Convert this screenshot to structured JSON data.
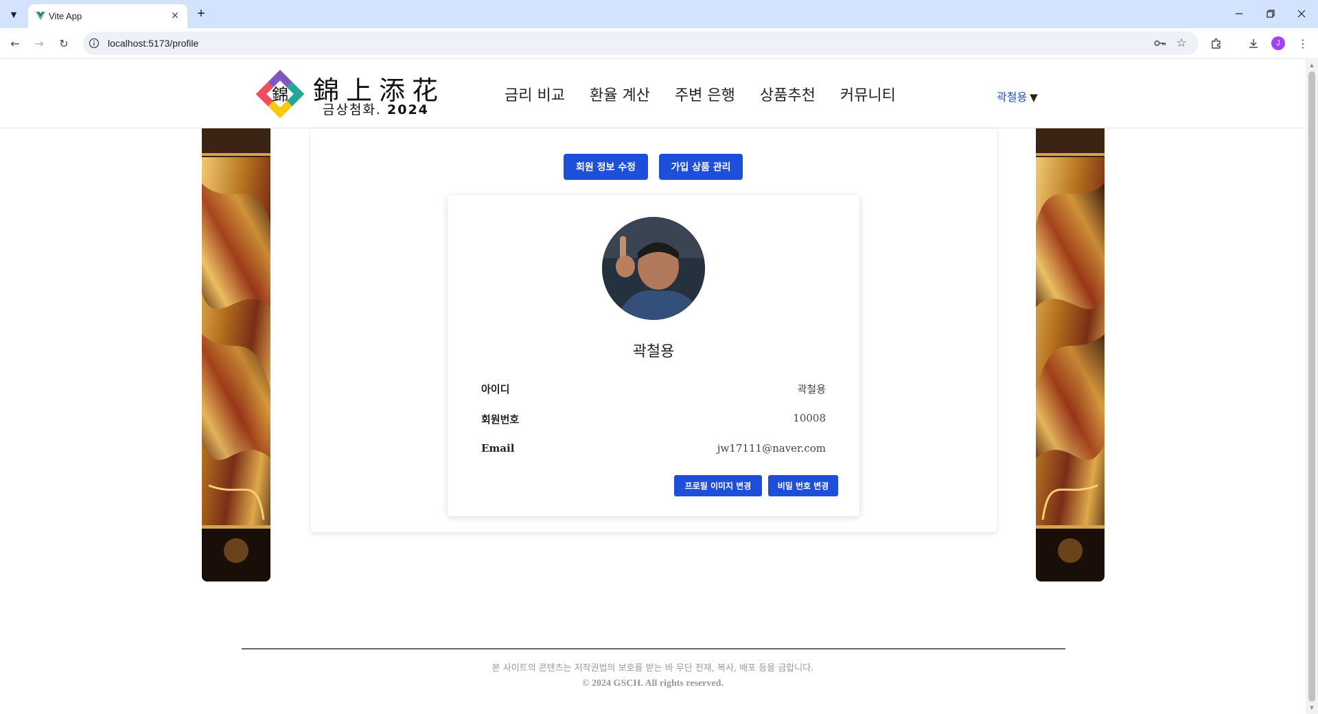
{
  "browser": {
    "tab_title": "Vite App",
    "url": "localhost:5173/profile",
    "profile_initial": "J"
  },
  "site": {
    "logo_title": "錦上添花",
    "logo_sub_text": "금상첨화.",
    "logo_year": "2024",
    "logo_glyph": "錦",
    "nav": [
      "금리 비교",
      "환율 계산",
      "주변 은행",
      "상품추천",
      "커뮤니티"
    ],
    "user_menu": "곽철용",
    "user_menu_caret": "▼"
  },
  "profile": {
    "edit_info_button": "회원 정보 수정",
    "manage_products_button": "가입 상품 관리",
    "name": "곽철용",
    "fields": [
      {
        "label": "아이디",
        "value": "곽철용"
      },
      {
        "label": "회원번호",
        "value": "10008"
      },
      {
        "label": "Email",
        "value": "jw17111@naver.com"
      }
    ],
    "change_image_button": "프로필 이미지 변경",
    "change_password_button": "비밀 번호 변경"
  },
  "footer": {
    "notice": "본 사이트의 콘텐츠는 저작권법의 보호를 받는 바 무단 전재, 복사, 배포 등을 금합니다.",
    "copyright": "© 2024 GSCH. All rights reserved."
  },
  "colors": {
    "accent": "#1d4fdb",
    "user_link": "#1d4fc4",
    "tabbar": "#d3e3fd"
  }
}
